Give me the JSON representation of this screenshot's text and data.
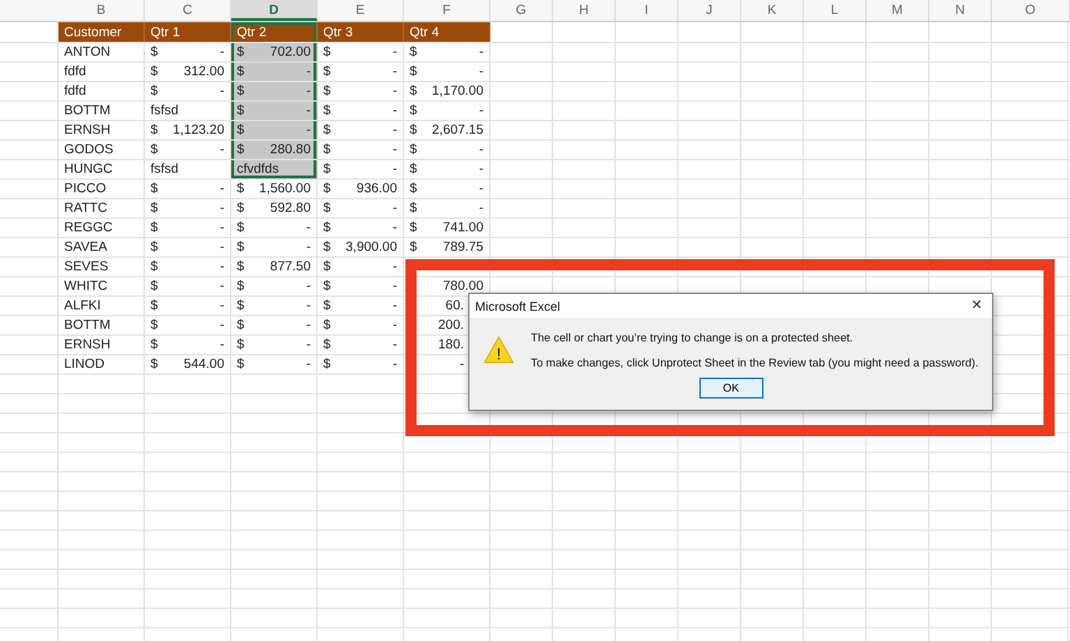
{
  "columns": [
    {
      "label": "B",
      "selected": false
    },
    {
      "label": "C",
      "selected": false
    },
    {
      "label": "D",
      "selected": true
    },
    {
      "label": "E",
      "selected": false
    },
    {
      "label": "F",
      "selected": false
    },
    {
      "label": "G",
      "selected": false
    },
    {
      "label": "H",
      "selected": false
    },
    {
      "label": "I",
      "selected": false
    },
    {
      "label": "J",
      "selected": false
    },
    {
      "label": "K",
      "selected": false
    },
    {
      "label": "L",
      "selected": false
    },
    {
      "label": "M",
      "selected": false
    },
    {
      "label": "N",
      "selected": false
    },
    {
      "label": "O",
      "selected": false
    }
  ],
  "header_row": [
    {
      "value": "Customer",
      "selected": false
    },
    {
      "value": "Qtr 1",
      "selected": false
    },
    {
      "value": "Qtr 2",
      "selected": true
    },
    {
      "value": "Qtr 3",
      "selected": false
    },
    {
      "value": "Qtr 4",
      "selected": false
    }
  ],
  "rows": [
    {
      "cells": [
        {
          "kind": "text",
          "value": "ANTON",
          "selected": false
        },
        {
          "kind": "currency",
          "symbol": "$",
          "value": "-",
          "selected": false
        },
        {
          "kind": "currency",
          "symbol": "$",
          "value": "702.00",
          "selected": true
        },
        {
          "kind": "currency",
          "symbol": "$",
          "value": "-",
          "selected": false
        },
        {
          "kind": "currency",
          "symbol": "$",
          "value": "-",
          "selected": false
        }
      ]
    },
    {
      "cells": [
        {
          "kind": "text",
          "value": "fdfd",
          "selected": false
        },
        {
          "kind": "currency",
          "symbol": "$",
          "value": "312.00",
          "selected": false
        },
        {
          "kind": "currency",
          "symbol": "$",
          "value": "-",
          "selected": true
        },
        {
          "kind": "currency",
          "symbol": "$",
          "value": "-",
          "selected": false
        },
        {
          "kind": "currency",
          "symbol": "$",
          "value": "-",
          "selected": false
        }
      ]
    },
    {
      "cells": [
        {
          "kind": "text",
          "value": "fdfd",
          "selected": false
        },
        {
          "kind": "currency",
          "symbol": "$",
          "value": "-",
          "selected": false
        },
        {
          "kind": "currency",
          "symbol": "$",
          "value": "-",
          "selected": true
        },
        {
          "kind": "currency",
          "symbol": "$",
          "value": "-",
          "selected": false
        },
        {
          "kind": "currency",
          "symbol": "$",
          "value": "1,170.00",
          "selected": false
        }
      ]
    },
    {
      "cells": [
        {
          "kind": "text",
          "value": "BOTTM",
          "selected": false
        },
        {
          "kind": "text",
          "value": "fsfsd",
          "selected": false
        },
        {
          "kind": "currency",
          "symbol": "$",
          "value": "-",
          "selected": true
        },
        {
          "kind": "currency",
          "symbol": "$",
          "value": "-",
          "selected": false
        },
        {
          "kind": "currency",
          "symbol": "$",
          "value": "-",
          "selected": false
        }
      ]
    },
    {
      "cells": [
        {
          "kind": "text",
          "value": "ERNSH",
          "selected": false
        },
        {
          "kind": "currency",
          "symbol": "$",
          "value": "1,123.20",
          "selected": false
        },
        {
          "kind": "currency",
          "symbol": "$",
          "value": "-",
          "selected": true
        },
        {
          "kind": "currency",
          "symbol": "$",
          "value": "-",
          "selected": false
        },
        {
          "kind": "currency",
          "symbol": "$",
          "value": "2,607.15",
          "selected": false
        }
      ]
    },
    {
      "cells": [
        {
          "kind": "text",
          "value": "GODOS",
          "selected": false
        },
        {
          "kind": "currency",
          "symbol": "$",
          "value": "-",
          "selected": false
        },
        {
          "kind": "currency",
          "symbol": "$",
          "value": "280.80",
          "selected": true
        },
        {
          "kind": "currency",
          "symbol": "$",
          "value": "-",
          "selected": false
        },
        {
          "kind": "currency",
          "symbol": "$",
          "value": "-",
          "selected": false
        }
      ]
    },
    {
      "cells": [
        {
          "kind": "text",
          "value": "HUNGC",
          "selected": false
        },
        {
          "kind": "text",
          "value": "fsfsd",
          "selected": false
        },
        {
          "kind": "text",
          "value": "cfvdfds",
          "selected": true
        },
        {
          "kind": "currency",
          "symbol": "$",
          "value": "-",
          "selected": false
        },
        {
          "kind": "currency",
          "symbol": "$",
          "value": "-",
          "selected": false
        }
      ]
    },
    {
      "cells": [
        {
          "kind": "text",
          "value": "PICCO",
          "selected": false
        },
        {
          "kind": "currency",
          "symbol": "$",
          "value": "-",
          "selected": false
        },
        {
          "kind": "currency",
          "symbol": "$",
          "value": "1,560.00",
          "selected": false
        },
        {
          "kind": "currency",
          "symbol": "$",
          "value": "936.00",
          "selected": false
        },
        {
          "kind": "currency",
          "symbol": "$",
          "value": "-",
          "selected": false
        }
      ]
    },
    {
      "cells": [
        {
          "kind": "text",
          "value": "RATTC",
          "selected": false
        },
        {
          "kind": "currency",
          "symbol": "$",
          "value": "-",
          "selected": false
        },
        {
          "kind": "currency",
          "symbol": "$",
          "value": "592.80",
          "selected": false
        },
        {
          "kind": "currency",
          "symbol": "$",
          "value": "-",
          "selected": false
        },
        {
          "kind": "currency",
          "symbol": "$",
          "value": "-",
          "selected": false
        }
      ]
    },
    {
      "cells": [
        {
          "kind": "text",
          "value": "REGGC",
          "selected": false
        },
        {
          "kind": "currency",
          "symbol": "$",
          "value": "-",
          "selected": false
        },
        {
          "kind": "currency",
          "symbol": "$",
          "value": "-",
          "selected": false
        },
        {
          "kind": "currency",
          "symbol": "$",
          "value": "-",
          "selected": false
        },
        {
          "kind": "currency",
          "symbol": "$",
          "value": "741.00",
          "selected": false
        }
      ]
    },
    {
      "cells": [
        {
          "kind": "text",
          "value": "SAVEA",
          "selected": false
        },
        {
          "kind": "currency",
          "symbol": "$",
          "value": "-",
          "selected": false
        },
        {
          "kind": "currency",
          "symbol": "$",
          "value": "-",
          "selected": false
        },
        {
          "kind": "currency",
          "symbol": "$",
          "value": "3,900.00",
          "selected": false
        },
        {
          "kind": "currency",
          "symbol": "$",
          "value": "789.75",
          "selected": false
        }
      ]
    },
    {
      "cells": [
        {
          "kind": "text",
          "value": "SEVES",
          "selected": false
        },
        {
          "kind": "currency",
          "symbol": "$",
          "value": "-",
          "selected": false
        },
        {
          "kind": "currency",
          "symbol": "$",
          "value": "877.50",
          "selected": false
        },
        {
          "kind": "currency",
          "symbol": "$",
          "value": "-",
          "selected": false
        }
      ]
    },
    {
      "cells": [
        {
          "kind": "text",
          "value": "WHITC",
          "selected": false
        },
        {
          "kind": "currency",
          "symbol": "$",
          "value": "-",
          "selected": false
        },
        {
          "kind": "currency",
          "symbol": "$",
          "value": "-",
          "selected": false
        },
        {
          "kind": "currency",
          "symbol": "$",
          "value": "-",
          "selected": false
        },
        {
          "kind": "partial",
          "value": "780.00",
          "selected": false
        }
      ]
    },
    {
      "cells": [
        {
          "kind": "text",
          "value": "ALFKI",
          "selected": false
        },
        {
          "kind": "currency",
          "symbol": "$",
          "value": "-",
          "selected": false
        },
        {
          "kind": "currency",
          "symbol": "$",
          "value": "-",
          "selected": false
        },
        {
          "kind": "currency",
          "symbol": "$",
          "value": "-",
          "selected": false
        },
        {
          "kind": "clipped",
          "value": "60.",
          "selected": false
        }
      ]
    },
    {
      "cells": [
        {
          "kind": "text",
          "value": "BOTTM",
          "selected": false
        },
        {
          "kind": "currency",
          "symbol": "$",
          "value": "-",
          "selected": false
        },
        {
          "kind": "currency",
          "symbol": "$",
          "value": "-",
          "selected": false
        },
        {
          "kind": "currency",
          "symbol": "$",
          "value": "-",
          "selected": false
        },
        {
          "kind": "clipped",
          "value": "200.",
          "selected": false
        }
      ]
    },
    {
      "cells": [
        {
          "kind": "text",
          "value": "ERNSH",
          "selected": false
        },
        {
          "kind": "currency",
          "symbol": "$",
          "value": "-",
          "selected": false
        },
        {
          "kind": "currency",
          "symbol": "$",
          "value": "-",
          "selected": false
        },
        {
          "kind": "currency",
          "symbol": "$",
          "value": "-",
          "selected": false
        },
        {
          "kind": "clipped",
          "value": "180.",
          "selected": false
        }
      ]
    },
    {
      "cells": [
        {
          "kind": "text",
          "value": "LINOD",
          "selected": false
        },
        {
          "kind": "currency",
          "symbol": "$",
          "value": "544.00",
          "selected": false
        },
        {
          "kind": "currency",
          "symbol": "$",
          "value": "-",
          "selected": false
        },
        {
          "kind": "currency",
          "symbol": "$",
          "value": "-",
          "selected": false
        },
        {
          "kind": "clipped",
          "value": "-",
          "selected": false
        }
      ]
    }
  ],
  "dialog": {
    "title": "Microsoft Excel",
    "close": "✕",
    "messages": [
      "The cell or chart you’re trying to change is on a protected sheet.",
      "To make changes, click Unprotect Sheet in the Review tab (you might need a password)."
    ],
    "icon": "!",
    "button": "OK"
  }
}
